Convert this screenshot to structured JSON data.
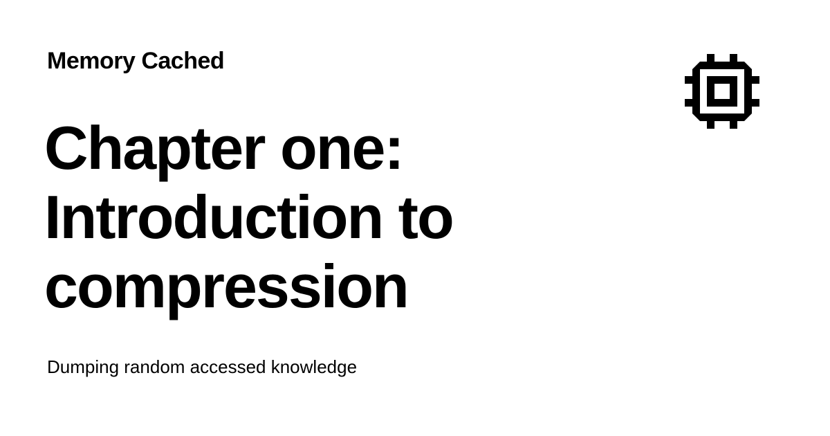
{
  "site": {
    "name": "Memory Cached",
    "tagline": "Dumping random accessed knowledge",
    "logo_icon": "microchip-icon"
  },
  "post": {
    "title_lines": [
      "Chapter one:",
      "Introduction to",
      "compression"
    ]
  },
  "colors": {
    "background": "#ffffff",
    "text": "#000000"
  }
}
